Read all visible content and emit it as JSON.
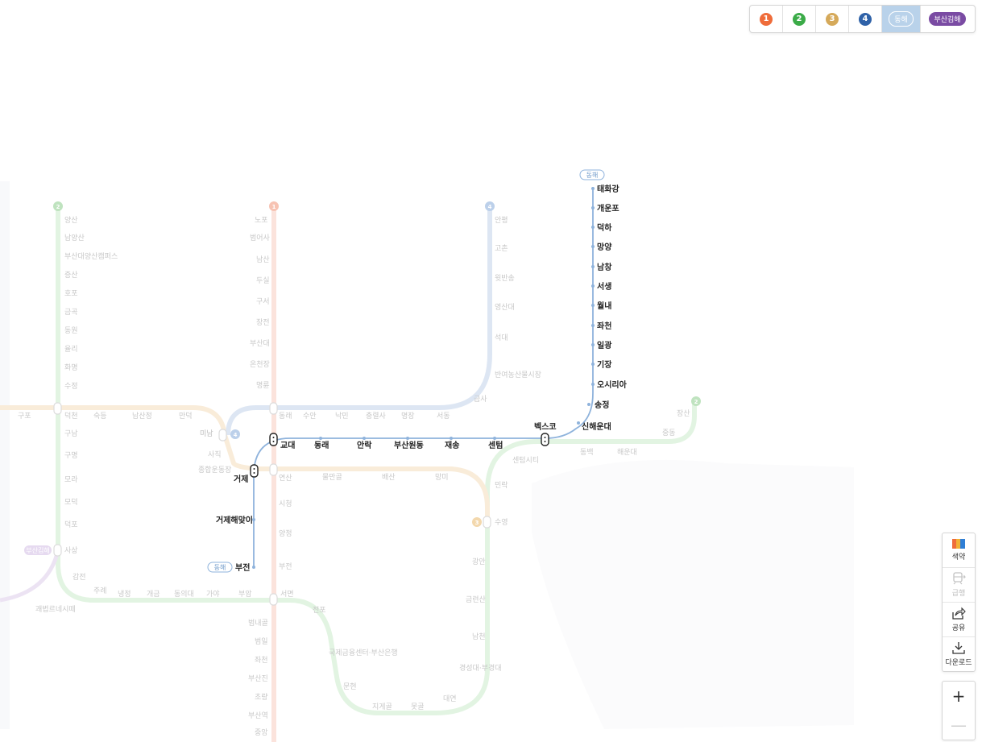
{
  "line_selector": {
    "buttons": [
      {
        "label": "1",
        "color": "#ef6c3a",
        "active": false
      },
      {
        "label": "2",
        "color": "#3bab48",
        "active": false
      },
      {
        "label": "3",
        "color": "#d5a95a",
        "active": false
      },
      {
        "label": "4",
        "color": "#2f62a8",
        "active": false
      },
      {
        "label": "동해",
        "color": "#7fa9d6",
        "active": true
      },
      {
        "label": "부산김해",
        "color": "#7a4ba3",
        "active": false
      }
    ]
  },
  "toolbar": {
    "colors_label": "색약",
    "express_label": "급행",
    "share_label": "공유",
    "download_label": "다운로드",
    "zoom_in": "+",
    "zoom_out": "—"
  },
  "map": {
    "colors": {
      "line1": "#fbe3dc",
      "line2": "#e2f4e2",
      "line3": "#f9ecd9",
      "line4": "#dde6f3",
      "donghae": "#8fb3dc",
      "gimhae": "#ece3f3",
      "faded_text": "#c8c8c8"
    },
    "line_badges": [
      {
        "label": "1",
        "color": "#f7c3b3"
      },
      {
        "label": "2",
        "color": "#bfe3bf"
      },
      {
        "label": "3",
        "color": "#f3d8ad"
      },
      {
        "label": "4",
        "color": "#bcd0ea"
      },
      {
        "label": "2",
        "color": "#bfe3bf"
      },
      {
        "label": "3",
        "color": "#f3d8ad"
      },
      {
        "label": "4",
        "color": "#bcd0ea"
      }
    ],
    "donghae_badges": [
      "동해",
      "동해"
    ],
    "gimhae_badge": "부산김해",
    "donghae_stations": [
      "태화강",
      "개운포",
      "덕하",
      "망양",
      "남창",
      "서생",
      "월내",
      "좌천",
      "일광",
      "기장",
      "오시리아",
      "송정",
      "신해운대",
      "벡스코",
      "교대",
      "동래",
      "안락",
      "부산원동",
      "재송",
      "센텀",
      "거제",
      "거제해맞이",
      "부전"
    ],
    "line1_stations": [
      "노포",
      "범어사",
      "남산",
      "두실",
      "구서",
      "장전",
      "부산대",
      "온천장",
      "명륜",
      "동래",
      "교대",
      "연산",
      "시청",
      "양정",
      "부전",
      "서면",
      "범내골",
      "범일",
      "좌천",
      "부산진",
      "초량",
      "부산역",
      "중앙"
    ],
    "line2_stations": [
      "양산",
      "남양산",
      "부산대양산캠퍼스",
      "증산",
      "호포",
      "금곡",
      "동원",
      "율리",
      "화명",
      "수정",
      "덕천",
      "구남",
      "구명",
      "모라",
      "모덕",
      "덕포",
      "사상",
      "감전",
      "주례",
      "냉정",
      "개금",
      "동의대",
      "가야",
      "부암",
      "서면",
      "전포",
      "국제금융센터·부산은행",
      "문현",
      "지게골",
      "못골",
      "대연",
      "경성대·부경대",
      "남천",
      "금련산",
      "광안",
      "수영",
      "민락",
      "센텀시티",
      "벡스코",
      "동백",
      "해운대",
      "중동",
      "장산"
    ],
    "line3_stations": [
      "구포",
      "숙등",
      "남산정",
      "만덕",
      "미남",
      "사직",
      "종합운동장",
      "거제",
      "연산",
      "물만골",
      "배산",
      "망미",
      "수영"
    ],
    "line4_stations": [
      "안평",
      "고촌",
      "윗반송",
      "영산대",
      "석대",
      "반여농산물시장",
      "금사",
      "서동",
      "명장",
      "충렬사",
      "낙민",
      "수안",
      "동래",
      "미남"
    ],
    "gimhae_stations": [
      "괘법르네시떼"
    ]
  }
}
